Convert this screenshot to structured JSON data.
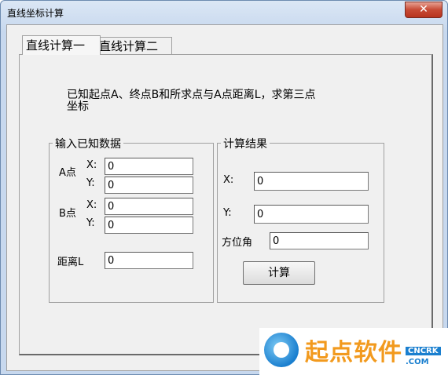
{
  "window": {
    "title": "直线坐标计算",
    "close_label": "✕"
  },
  "tabs": [
    {
      "label": "直线计算一",
      "active": true
    },
    {
      "label": "直线计算二",
      "active": false
    }
  ],
  "description": "已知起点A、终点B和所求点与A点距离L，求第三点坐标",
  "input_group": {
    "legend": "输入已知数据",
    "point_a_label": "A点",
    "point_b_label": "B点",
    "x_label": "X:",
    "y_label": "Y:",
    "a_x": "0",
    "a_y": "0",
    "b_x": "0",
    "b_y": "0",
    "distance_label": "距离L",
    "distance": "0"
  },
  "result_group": {
    "legend": "计算结果",
    "x_label": "X:",
    "y_label": "Y:",
    "azimuth_label": "方位角",
    "x": "0",
    "y": "0",
    "azimuth": "0",
    "calc_button": "计算"
  },
  "watermark": {
    "brand": "起点软件",
    "tag": "CNCRK",
    "domain": ".COM"
  }
}
